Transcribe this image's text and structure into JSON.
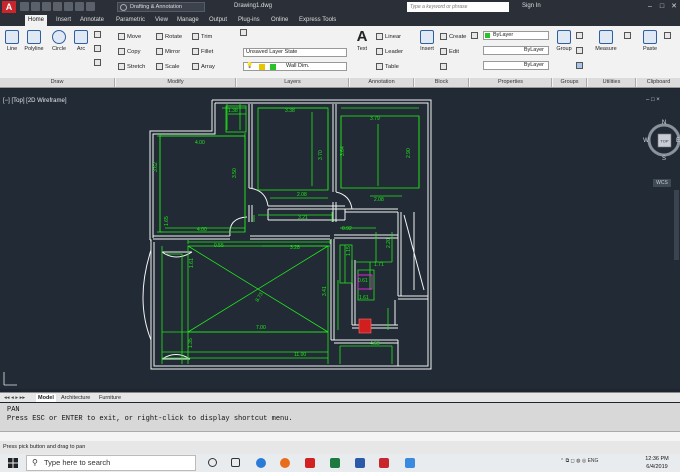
{
  "titlebar": {
    "app_logo": "A",
    "workspace": "Drafting & Annotation",
    "file_title": "Drawing1.dwg",
    "search_placeholder": "Type a keyword or phrase",
    "sign_in": "Sign In"
  },
  "tabs": [
    "Home",
    "Insert",
    "Annotate",
    "Parametric",
    "View",
    "Manage",
    "Output",
    "Plug-ins",
    "Online",
    "Express Tools"
  ],
  "ribbon": {
    "draw": {
      "title": "Draw",
      "line": "Line",
      "polyline": "Polyline",
      "circle": "Circle",
      "arc": "Arc"
    },
    "modify": {
      "title": "Modify",
      "move": "Move",
      "rotate": "Rotate",
      "trim": "Trim",
      "copy": "Copy",
      "mirror": "Mirror",
      "fillet": "Fillet",
      "stretch": "Stretch",
      "scale": "Scale",
      "array": "Array"
    },
    "layers": {
      "title": "Layers",
      "layer_state": "Unsaved Layer State",
      "current_layer": "Wall Dim."
    },
    "annotation": {
      "title": "Annotation",
      "text": "Text",
      "linear": "Linear",
      "leader": "Leader",
      "table": "Table"
    },
    "block": {
      "title": "Block",
      "insert": "Insert",
      "create": "Create",
      "edit": "Edit"
    },
    "properties": {
      "title": "Properties",
      "color": "ByLayer",
      "linetype": "ByLayer",
      "lineweight": "ByLayer"
    },
    "groups": {
      "title": "Groups",
      "group": "Group"
    },
    "utilities": {
      "title": "Utilities",
      "measure": "Measure"
    },
    "clipboard": {
      "title": "Clipboard",
      "paste": "Paste"
    }
  },
  "viewport": {
    "label": "[−] [Top] [2D Wireframe]",
    "viewcube_face": "TOP",
    "compass_n": "N",
    "compass_s": "S",
    "compass_e": "E",
    "compass_w": "W",
    "wcs": "WCS"
  },
  "dimensions": {
    "d1": "1.38",
    "d2": "3.38",
    "d3": "3.79",
    "d4": "4.00",
    "d5": "3.62",
    "d6": "3.70",
    "d7": "3.50",
    "d8": "3.64",
    "d9": "2.90",
    "d10": "2.08",
    "d11": "3.21",
    "d12": "2.08",
    "d13": "4.00",
    "d14": "0.55",
    "d15": "3.28",
    "d16": "0.92",
    "d17": "1.71",
    "d18": "1.15",
    "d19": "2.20",
    "d20": "1.61",
    "d21": "8.73",
    "d22": "3.41",
    "d23": "7.00",
    "d24": "11.00",
    "d25": "4.59",
    "d26": "1.61",
    "d27": "1.35",
    "d28": "1.65",
    "d29": "0.61"
  },
  "layouts": [
    "Model",
    "Architecture",
    "Furniture"
  ],
  "command": {
    "history1": "PAN",
    "history2": "Press ESC or ENTER to exit, or right-click to display shortcut menu."
  },
  "status": {
    "text": "Press pick button and drag to pan"
  },
  "taskbar": {
    "search": "Type here to search",
    "lang": "ENG",
    "time": "12:36 PM",
    "date": "6/4/2019"
  },
  "colors": {
    "dim_green": "#22e81c",
    "wall_white": "#f4f4f4",
    "accent_red": "#d11f1f",
    "magenta": "#d22fd2"
  }
}
